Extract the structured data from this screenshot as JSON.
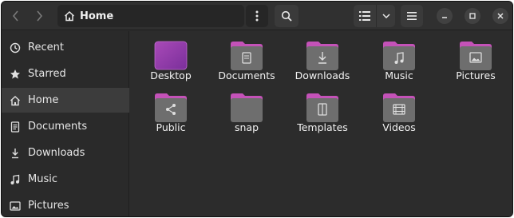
{
  "window": {
    "title": "Home"
  },
  "pathbar": {
    "crumb": "Home"
  },
  "sidebar": {
    "items": [
      {
        "label": "Recent",
        "icon": "clock-icon"
      },
      {
        "label": "Starred",
        "icon": "star-icon"
      },
      {
        "label": "Home",
        "icon": "home-icon",
        "active": true
      },
      {
        "label": "Documents",
        "icon": "document-icon"
      },
      {
        "label": "Downloads",
        "icon": "download-icon"
      },
      {
        "label": "Music",
        "icon": "music-icon"
      },
      {
        "label": "Pictures",
        "icon": "picture-icon"
      }
    ]
  },
  "files": [
    {
      "name": "Desktop",
      "icon": "desktop-folder-icon"
    },
    {
      "name": "Documents",
      "icon": "documents-folder-icon"
    },
    {
      "name": "Downloads",
      "icon": "downloads-folder-icon"
    },
    {
      "name": "Music",
      "icon": "music-folder-icon"
    },
    {
      "name": "Pictures",
      "icon": "pictures-folder-icon"
    },
    {
      "name": "Public",
      "icon": "public-folder-icon"
    },
    {
      "name": "snap",
      "icon": "folder-icon"
    },
    {
      "name": "Templates",
      "icon": "templates-folder-icon"
    },
    {
      "name": "Videos",
      "icon": "videos-folder-icon"
    }
  ],
  "colors": {
    "folder_tab": "#c452b8",
    "folder_body": "#6e6e6e",
    "accent": "#9b4fb0"
  }
}
